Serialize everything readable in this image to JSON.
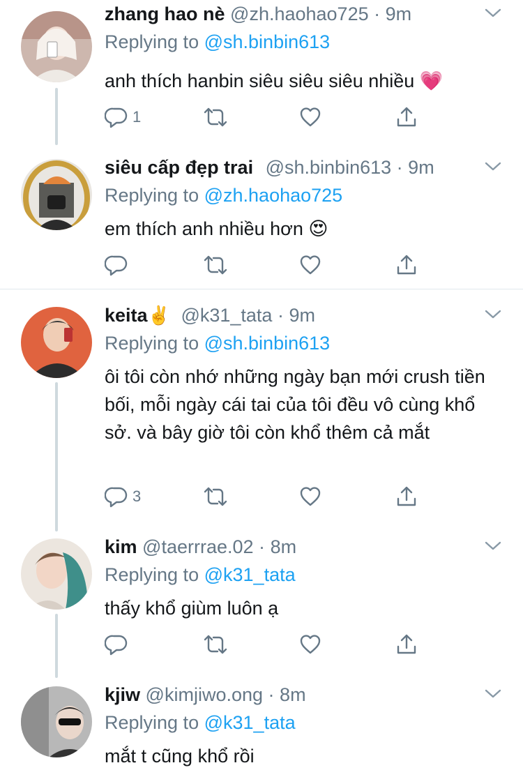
{
  "tweets": [
    {
      "name": "zhang hao nè",
      "handle": "@zh.haohao725",
      "dot": "·",
      "time": "9m",
      "reply_prefix": "Replying to",
      "reply_to": "@sh.binbin613",
      "text": "anh thích hanbin siêu siêu siêu nhiều 💗",
      "reply_count": "1",
      "avatar_colors": [
        "#d9c7c0",
        "#8a6f66"
      ]
    },
    {
      "name": "siêu cấp đẹp trai",
      "handle": "@sh.binbin613",
      "dot": "·",
      "time": "9m",
      "reply_prefix": "Replying to",
      "reply_to": "@zh.haohao725",
      "text": "em thích anh nhiều hơn 😍",
      "reply_count": "",
      "avatar_colors": [
        "#c9a24a",
        "#e08a3a"
      ]
    },
    {
      "name": "keita",
      "name_emoji": "✌️",
      "handle": "@k31_tata",
      "dot": "·",
      "time": "9m",
      "reply_prefix": "Replying to",
      "reply_to": "@sh.binbin613",
      "text": "ôi tôi còn nhớ những ngày bạn mới crush tiền bối, mỗi ngày cái tai của tôi đều vô cùng khổ sở. và bây giờ tôi còn khổ thêm cả mắt",
      "reply_count": "3",
      "avatar_colors": [
        "#e0633f",
        "#2a2a2a"
      ]
    },
    {
      "name": "kim",
      "handle": "@taerrrae.02",
      "dot": "·",
      "time": "8m",
      "reply_prefix": "Replying to",
      "reply_to": "@k31_tata",
      "text": "thấy khổ giùm luôn ạ",
      "reply_count": "",
      "avatar_colors": [
        "#e9e3dc",
        "#3f8f8a"
      ]
    },
    {
      "name": "kjiw",
      "handle": "@kimjiwo.ong",
      "dot": "·",
      "time": "8m",
      "reply_prefix": "Replying to",
      "reply_to": "@k31_tata",
      "text": "mắt t cũng khổ rồi",
      "reply_count": "",
      "avatar_colors": [
        "#a9a9a9",
        "#3b3b3b"
      ]
    }
  ]
}
